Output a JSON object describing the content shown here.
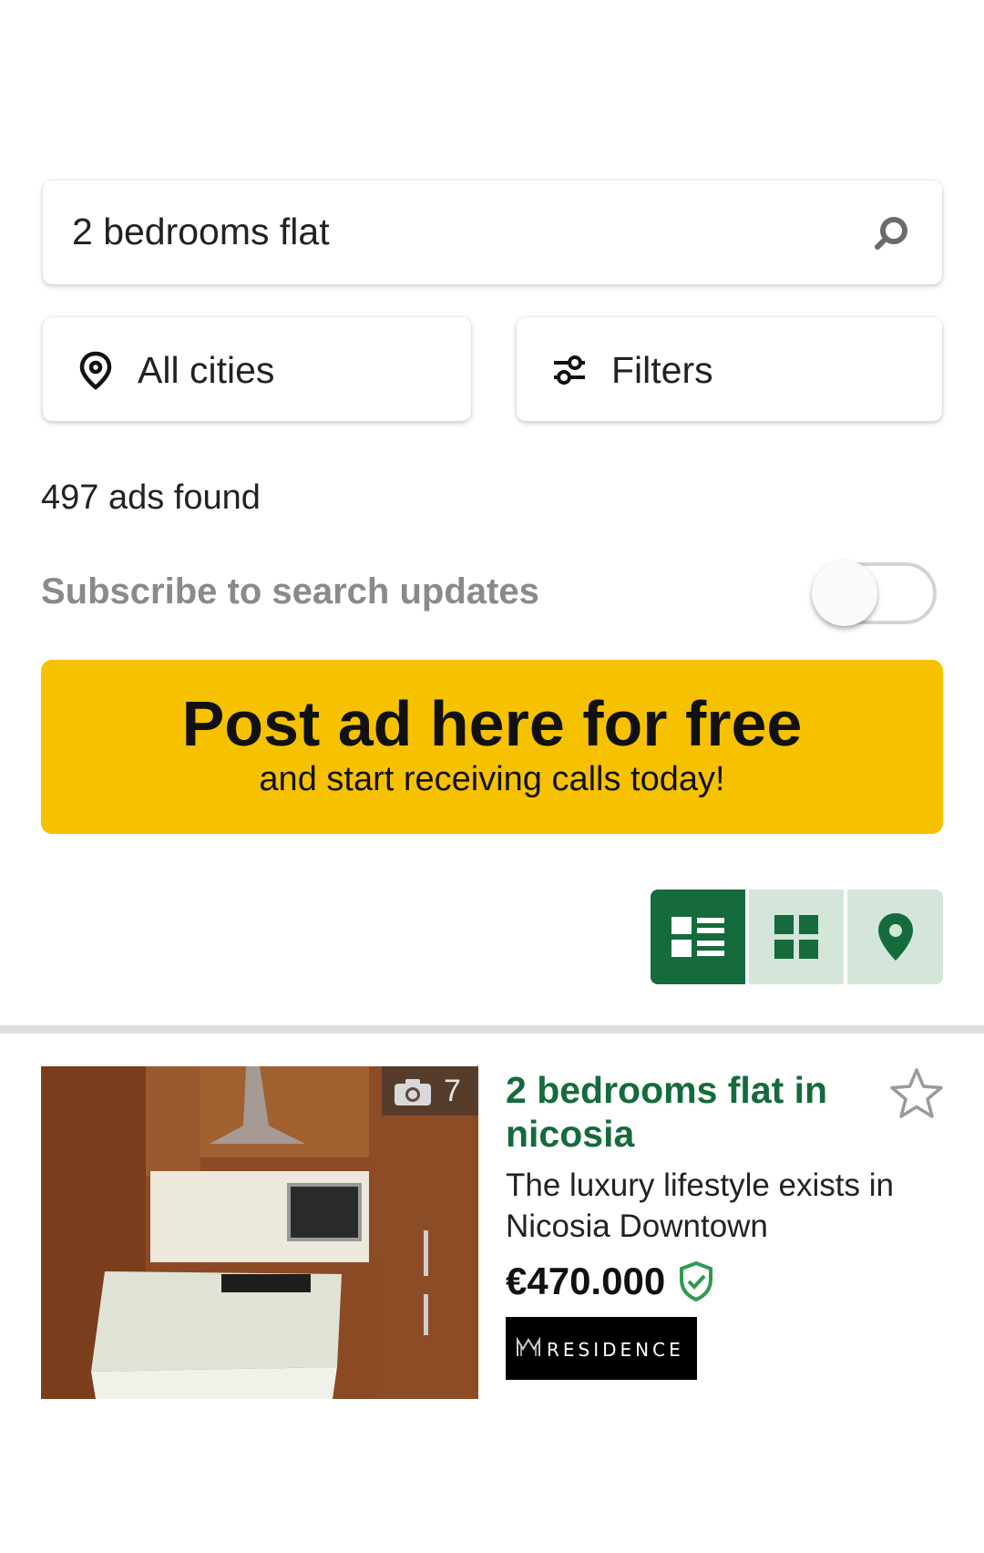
{
  "search": {
    "query": "2 bedrooms flat",
    "icon": "search-icon"
  },
  "location_button": {
    "label": "All cities",
    "icon": "location-pin-icon"
  },
  "filters_button": {
    "label": "Filters",
    "icon": "sliders-icon"
  },
  "results": {
    "count_text": "497 ads found"
  },
  "subscribe": {
    "label": "Subscribe to search updates",
    "enabled": false
  },
  "promo": {
    "title": "Post ad here for free",
    "subtitle": "and start receiving calls today!",
    "color": "#f6c200"
  },
  "view_modes": {
    "active": "list",
    "options": [
      "list",
      "grid",
      "map"
    ],
    "accent": "#156b3b"
  },
  "listings": [
    {
      "title": "2 bedrooms flat in nicosia",
      "description": "The luxury lifestyle exists in Nicosia Downtown",
      "price": "€470.000",
      "photo_count": "7",
      "verified": true,
      "agency_logo_text": "RESIDENCE",
      "favorite": false
    }
  ]
}
